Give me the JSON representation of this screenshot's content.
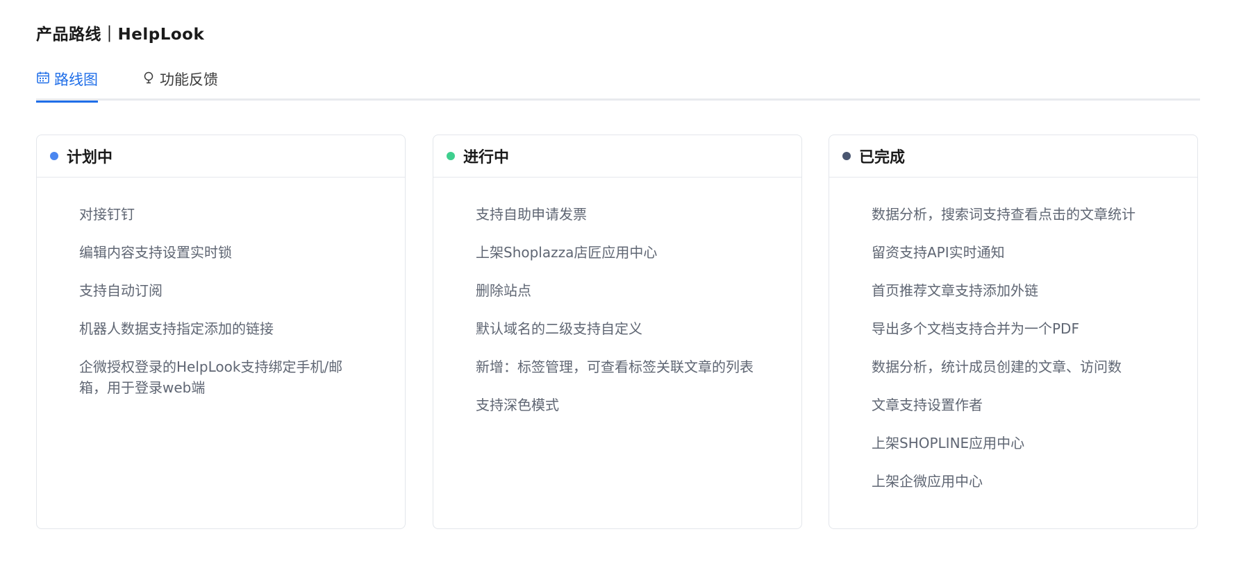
{
  "header": {
    "title": "产品路线｜HelpLook"
  },
  "tabs": [
    {
      "label": "路线图",
      "icon": "calendar-icon",
      "active": true
    },
    {
      "label": "功能反馈",
      "icon": "lightbulb-icon",
      "active": false
    }
  ],
  "colors": {
    "accent": "#1f6ee8",
    "planned_dot": "#4a86f0",
    "in_progress_dot": "#3ecf8e",
    "done_dot": "#4a5670"
  },
  "columns": [
    {
      "title": "计划中",
      "items": [
        "对接钉钉",
        "编辑内容支持设置实时锁",
        "支持自动订阅",
        "机器人数据支持指定添加的链接",
        "企微授权登录的HelpLook支持绑定手机/邮箱，用于登录web端"
      ]
    },
    {
      "title": "进行中",
      "items": [
        "支持自助申请发票",
        "上架Shoplazza店匠应用中心",
        "删除站点",
        "默认域名的二级支持自定义",
        "新增：标签管理，可查看标签关联文章的列表",
        "支持深色模式"
      ]
    },
    {
      "title": "已完成",
      "items": [
        "数据分析，搜索词支持查看点击的文章统计",
        "留资支持API实时通知",
        "首页推荐文章支持添加外链",
        "导出多个文档支持合并为一个PDF",
        "数据分析，统计成员创建的文章、访问数",
        "文章支持设置作者",
        "上架SHOPLINE应用中心",
        "上架企微应用中心"
      ]
    }
  ]
}
